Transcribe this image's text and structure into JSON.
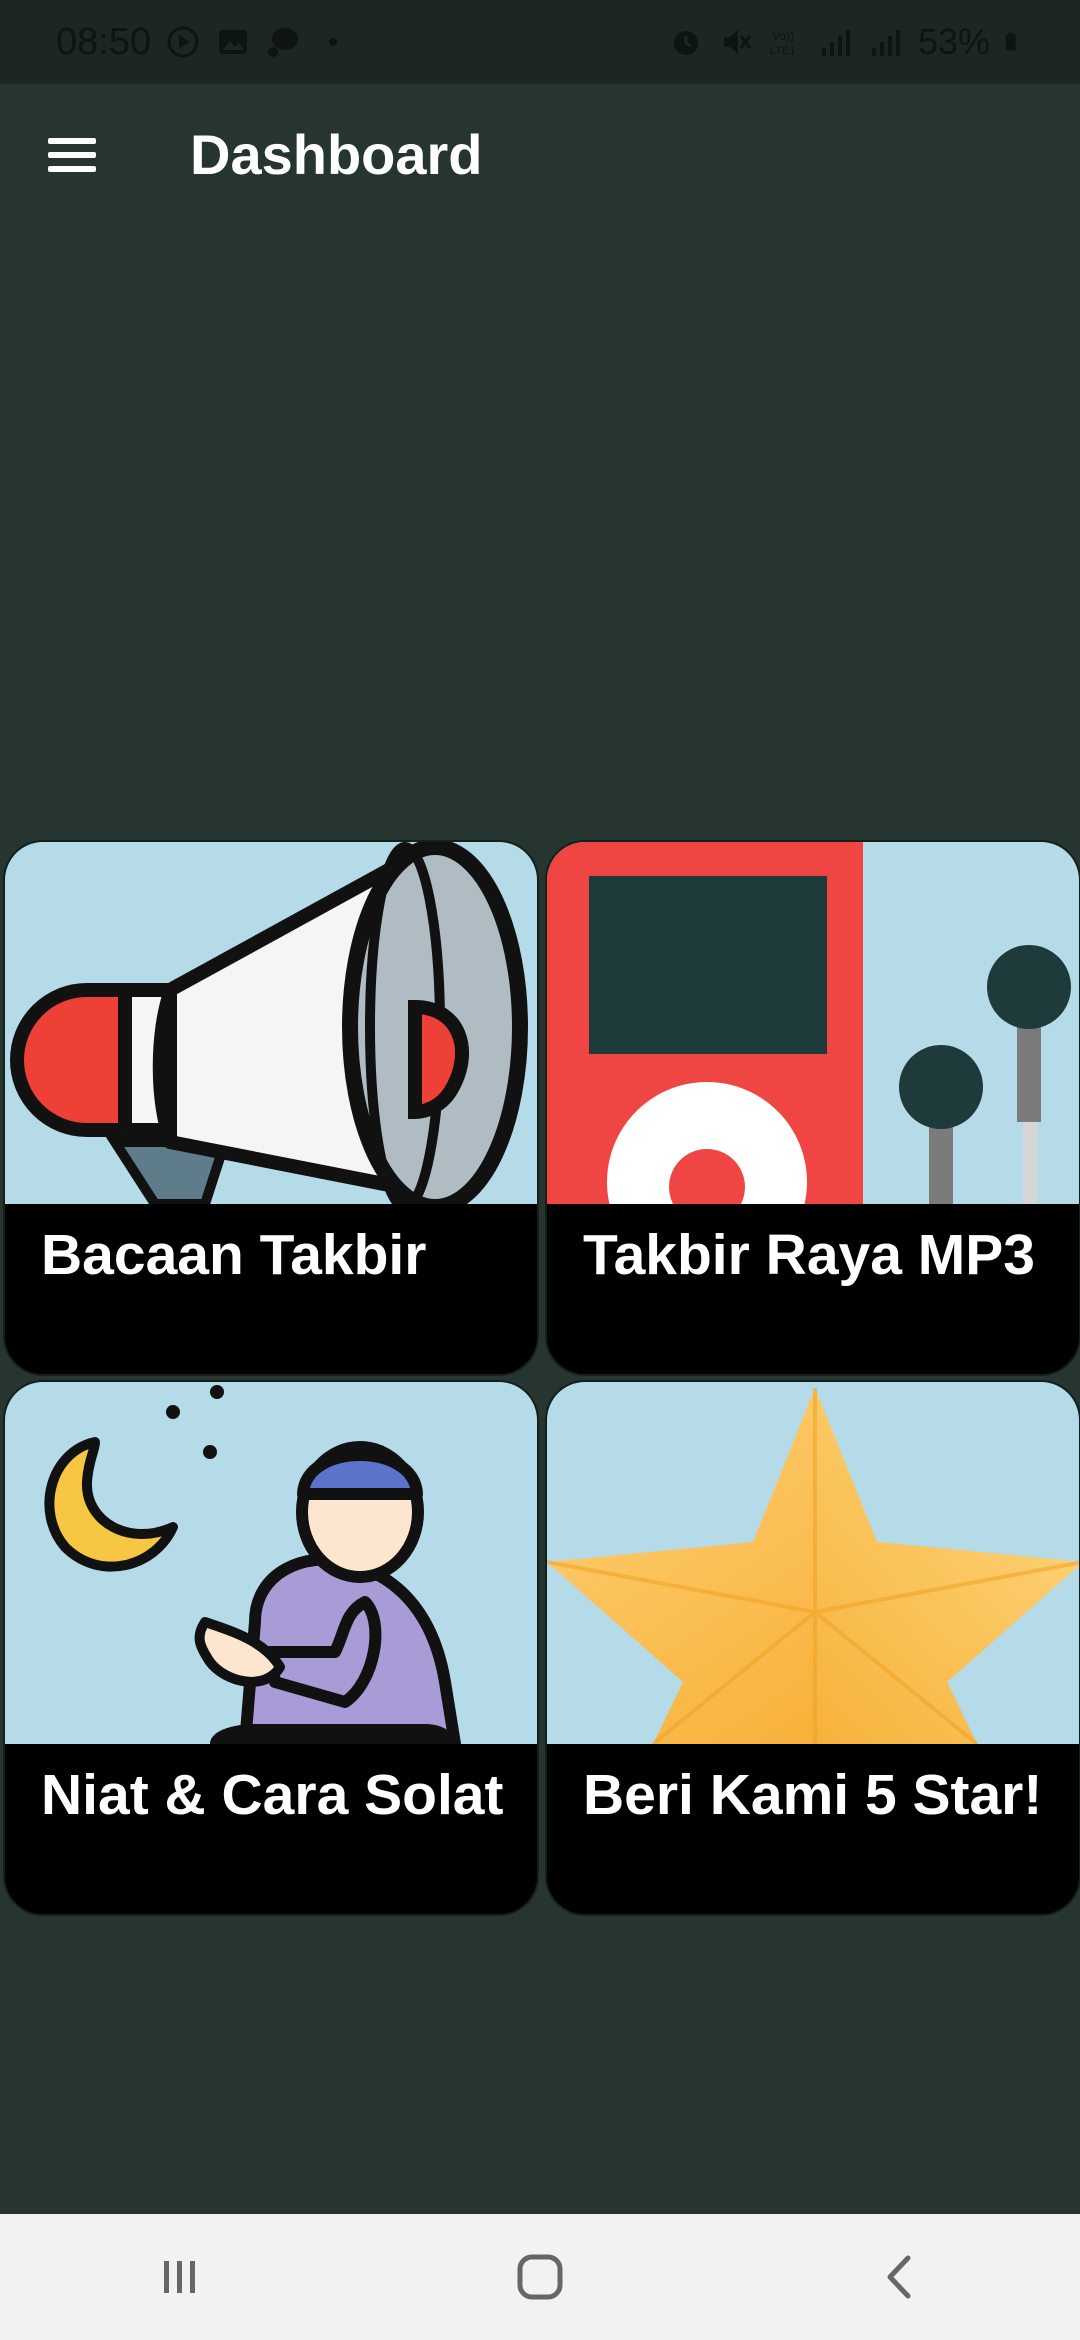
{
  "status_bar": {
    "time": "08:50",
    "battery": "53%",
    "icons": [
      "play-icon",
      "image-icon",
      "chat-bubble-icon",
      "dot-icon",
      "alarm-icon",
      "mute-icon",
      "volte-icon",
      "signal-icon",
      "signal-icon",
      "battery-icon"
    ]
  },
  "app_bar": {
    "title": "Dashboard",
    "menu_icon": "hamburger-menu-icon"
  },
  "tiles": [
    {
      "label": "Bacaan Takbir",
      "icon": "megaphone-icon"
    },
    {
      "label": "Takbir Raya MP3",
      "icon": "mp3-player-icon"
    },
    {
      "label": "Niat & Cara Solat",
      "icon": "praying-man-moon-icon"
    },
    {
      "label": "Beri Kami 5 Star!",
      "icon": "star-icon"
    }
  ],
  "nav_bar": {
    "recents_icon": "recents-icon",
    "home_icon": "home-icon",
    "back_icon": "back-icon"
  },
  "colors": {
    "background": "#263530",
    "status_bar": "#1c2622",
    "tile_image_bg": "#b5dbe9",
    "tile_label_bg": "#000000",
    "nav_bar": "#f2f2f2"
  }
}
